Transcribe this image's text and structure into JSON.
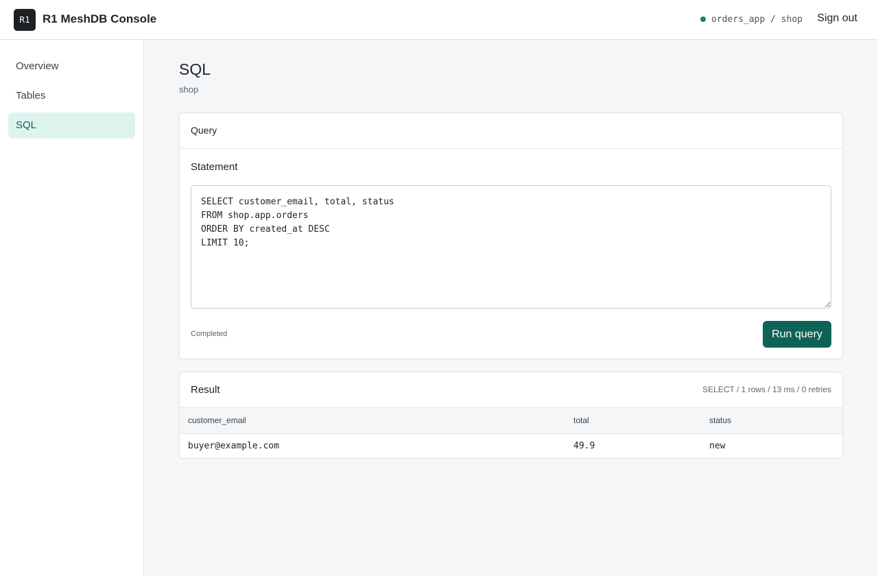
{
  "header": {
    "logo_text": "R1",
    "app_title": "R1 MeshDB Console",
    "connection": "orders_app / shop",
    "sign_out": "Sign out",
    "status_color": "#17865a"
  },
  "sidebar": {
    "items": [
      {
        "label": "Overview",
        "active": false
      },
      {
        "label": "Tables",
        "active": false
      },
      {
        "label": "SQL",
        "active": true
      }
    ]
  },
  "page": {
    "title": "SQL",
    "subtitle": "shop"
  },
  "query_card": {
    "title": "Query",
    "statement_label": "Statement",
    "sql": "SELECT customer_email, total, status\nFROM shop.app.orders\nORDER BY created_at DESC\nLIMIT 10;",
    "status": "Completed",
    "run_label": "Run query"
  },
  "result_card": {
    "title": "Result",
    "stats": "SELECT / 1 rows / 13 ms / 0 retries",
    "columns": [
      "customer_email",
      "total",
      "status"
    ],
    "rows": [
      [
        "buyer@example.com",
        "49.9",
        "new"
      ]
    ]
  },
  "colors": {
    "accent": "#0f6356",
    "active_nav_bg": "#dff3ee"
  }
}
